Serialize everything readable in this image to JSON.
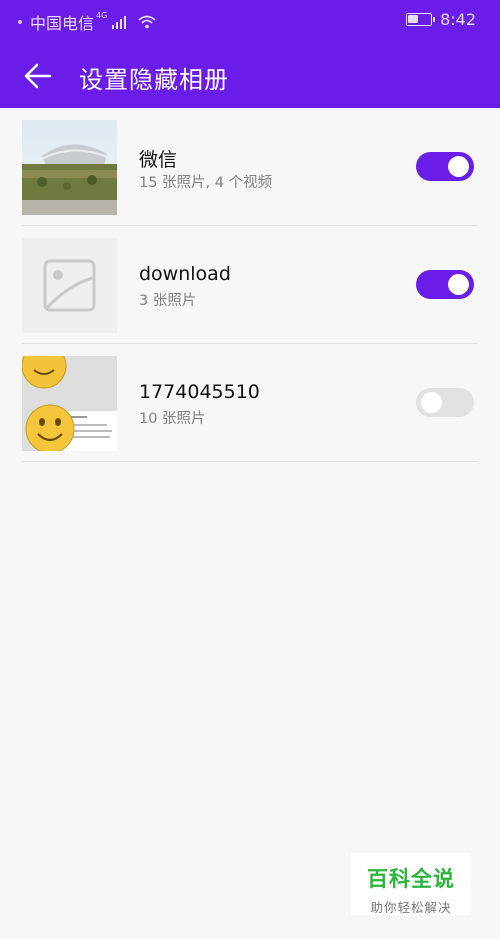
{
  "status_bar": {
    "carrier": "中国电信",
    "network": "4G",
    "time": "8:42"
  },
  "header": {
    "title": "设置隐藏相册",
    "back_icon": "arrow-left-icon"
  },
  "albums": [
    {
      "name": "微信",
      "subtitle": "15 张照片, 4 个视频",
      "hidden": true
    },
    {
      "name": "download",
      "subtitle": "3 张照片",
      "hidden": true
    },
    {
      "name": "1774045510",
      "subtitle": "10 张照片",
      "hidden": false
    }
  ],
  "watermark": {
    "title": "百科全说",
    "subtitle": "助你轻松解决"
  },
  "colors": {
    "accent": "#6a1ce8",
    "toggle_off": "#e1e1e1",
    "watermark_green": "#2cb33b"
  }
}
